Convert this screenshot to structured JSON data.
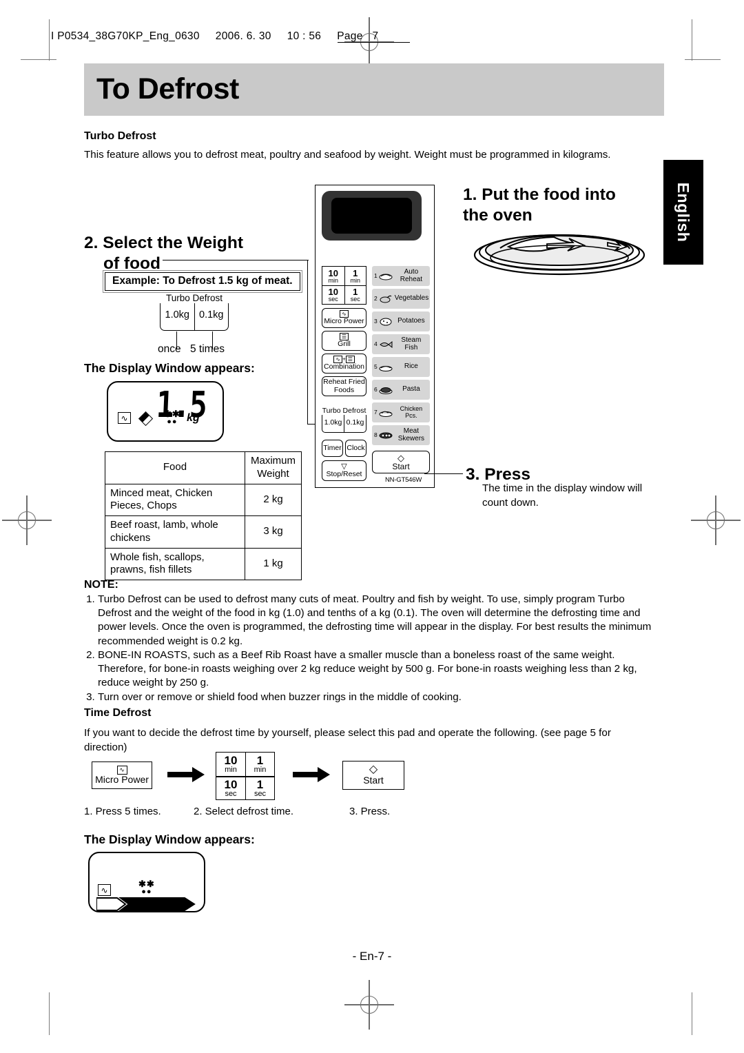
{
  "header": {
    "print_meta": "I P0534_38G70KP_Eng_0630     2006. 6. 30     10 : 56     Page   7"
  },
  "title": "To Defrost",
  "side_tab": "English",
  "turbo_defrost": {
    "heading": "Turbo Defrost",
    "intro": "This feature allows you to defrost meat, poultry and seafood by weight. Weight must be programmed in kilograms."
  },
  "step1": {
    "number": "1.",
    "title": "Put the food into the oven"
  },
  "step2": {
    "number": "2.",
    "title_line1": "Select the Weight",
    "title_line2": "of food",
    "example": "Example: To Defrost 1.5 kg of meat.",
    "pad_caption": "Turbo Defrost",
    "pad_left": "1.0kg",
    "pad_right": "0.1kg",
    "leader_left": "once",
    "leader_right": "5 times",
    "display_heading": "The Display Window appears:",
    "display_value": "1.5",
    "display_unit": "kg"
  },
  "step3": {
    "number": "3.",
    "title": "Press",
    "body": "The time in the display window will count down."
  },
  "food_table": {
    "headers": [
      "Food",
      "Maximum Weight"
    ],
    "header_max_line1": "Maximum",
    "header_max_line2": "Weight",
    "rows": [
      {
        "food": "Minced meat, Chicken Pieces, Chops",
        "weight": "2 kg"
      },
      {
        "food": "Beef roast, lamb, whole chickens",
        "weight": "3 kg"
      },
      {
        "food": "Whole fish, scallops, prawns, fish fillets",
        "weight": "1 kg"
      }
    ]
  },
  "control_panel": {
    "model": "NN-GT546W",
    "number_pad": [
      {
        "big": "10",
        "small": "min"
      },
      {
        "big": "1",
        "small": "min"
      },
      {
        "big": "10",
        "small": "sec"
      },
      {
        "big": "1",
        "small": "sec"
      }
    ],
    "left_buttons": [
      {
        "icon": "micro-power-icon",
        "label": "Micro Power"
      },
      {
        "icon": "grill-icon",
        "label": "Grill"
      },
      {
        "icon": "combination-icon",
        "label": "Combination"
      },
      {
        "icon": "",
        "label": "Reheat Fried Foods"
      }
    ],
    "turbo_defrost": {
      "caption": "Turbo Defrost",
      "left": "1.0kg",
      "right": "0.1kg"
    },
    "timer_label": "Timer",
    "clock_label": "Clock",
    "stop_label": "Stop/Reset",
    "start_label": "Start",
    "auto_menu": [
      {
        "num": "1",
        "icon": "auto-reheat-icon",
        "label": "Auto Reheat"
      },
      {
        "num": "2",
        "icon": "vegetables-icon",
        "label": "Vegetables"
      },
      {
        "num": "3",
        "icon": "potatoes-icon",
        "label": "Potatoes"
      },
      {
        "num": "4",
        "icon": "steam-fish-icon",
        "label": "Steam Fish"
      },
      {
        "num": "5",
        "icon": "rice-icon",
        "label": "Rice"
      },
      {
        "num": "6",
        "icon": "pasta-icon",
        "label": "Pasta"
      },
      {
        "num": "7",
        "icon": "chicken-pcs-icon",
        "label": "Chicken Pcs."
      },
      {
        "num": "8",
        "icon": "meat-skewers-icon",
        "label": "Meat Skewers"
      }
    ]
  },
  "note": {
    "heading": "NOTE:",
    "items": [
      "Turbo Defrost can be used to defrost many cuts of meat. Poultry and fish by weight. To use, simply program Turbo Defrost and the weight of the food in kg (1.0) and tenths of a kg (0.1). The oven will determine the defrosting time and power levels. Once the oven is programmed, the defrosting time will appear in the display. For best results the minimum recommended weight is 0.2 kg.",
      "BONE-IN ROASTS, such as a Beef Rib Roast have a smaller muscle than a boneless roast of the same weight. Therefore, for bone-in roasts weighing over 2 kg reduce weight by 500 g. For bone-in roasts weighing less than 2 kg, reduce weight by 250 g.",
      "Turn over or remove or shield food when buzzer rings in the middle of cooking."
    ]
  },
  "time_defrost": {
    "heading": "Time Defrost",
    "intro": "If you want to decide the defrost time by yourself, please select this pad and operate the following. (see page 5 for direction)",
    "btn_micro_power": "Micro Power",
    "pad": [
      {
        "big": "10",
        "small": "min"
      },
      {
        "big": "1",
        "small": "min"
      },
      {
        "big": "10",
        "small": "sec"
      },
      {
        "big": "1",
        "small": "sec"
      }
    ],
    "btn_start": "Start",
    "caption1": "1. Press 5 times.",
    "caption2": "2. Select defrost time.",
    "caption3": "3. Press.",
    "display_heading": "The Display Window appears:"
  },
  "footer": {
    "page": "- En-7 -"
  },
  "colors": {
    "title_band": "#c9c9c9",
    "tab_bg": "#000000",
    "panel_btn_grey": "#d6d6d6"
  }
}
